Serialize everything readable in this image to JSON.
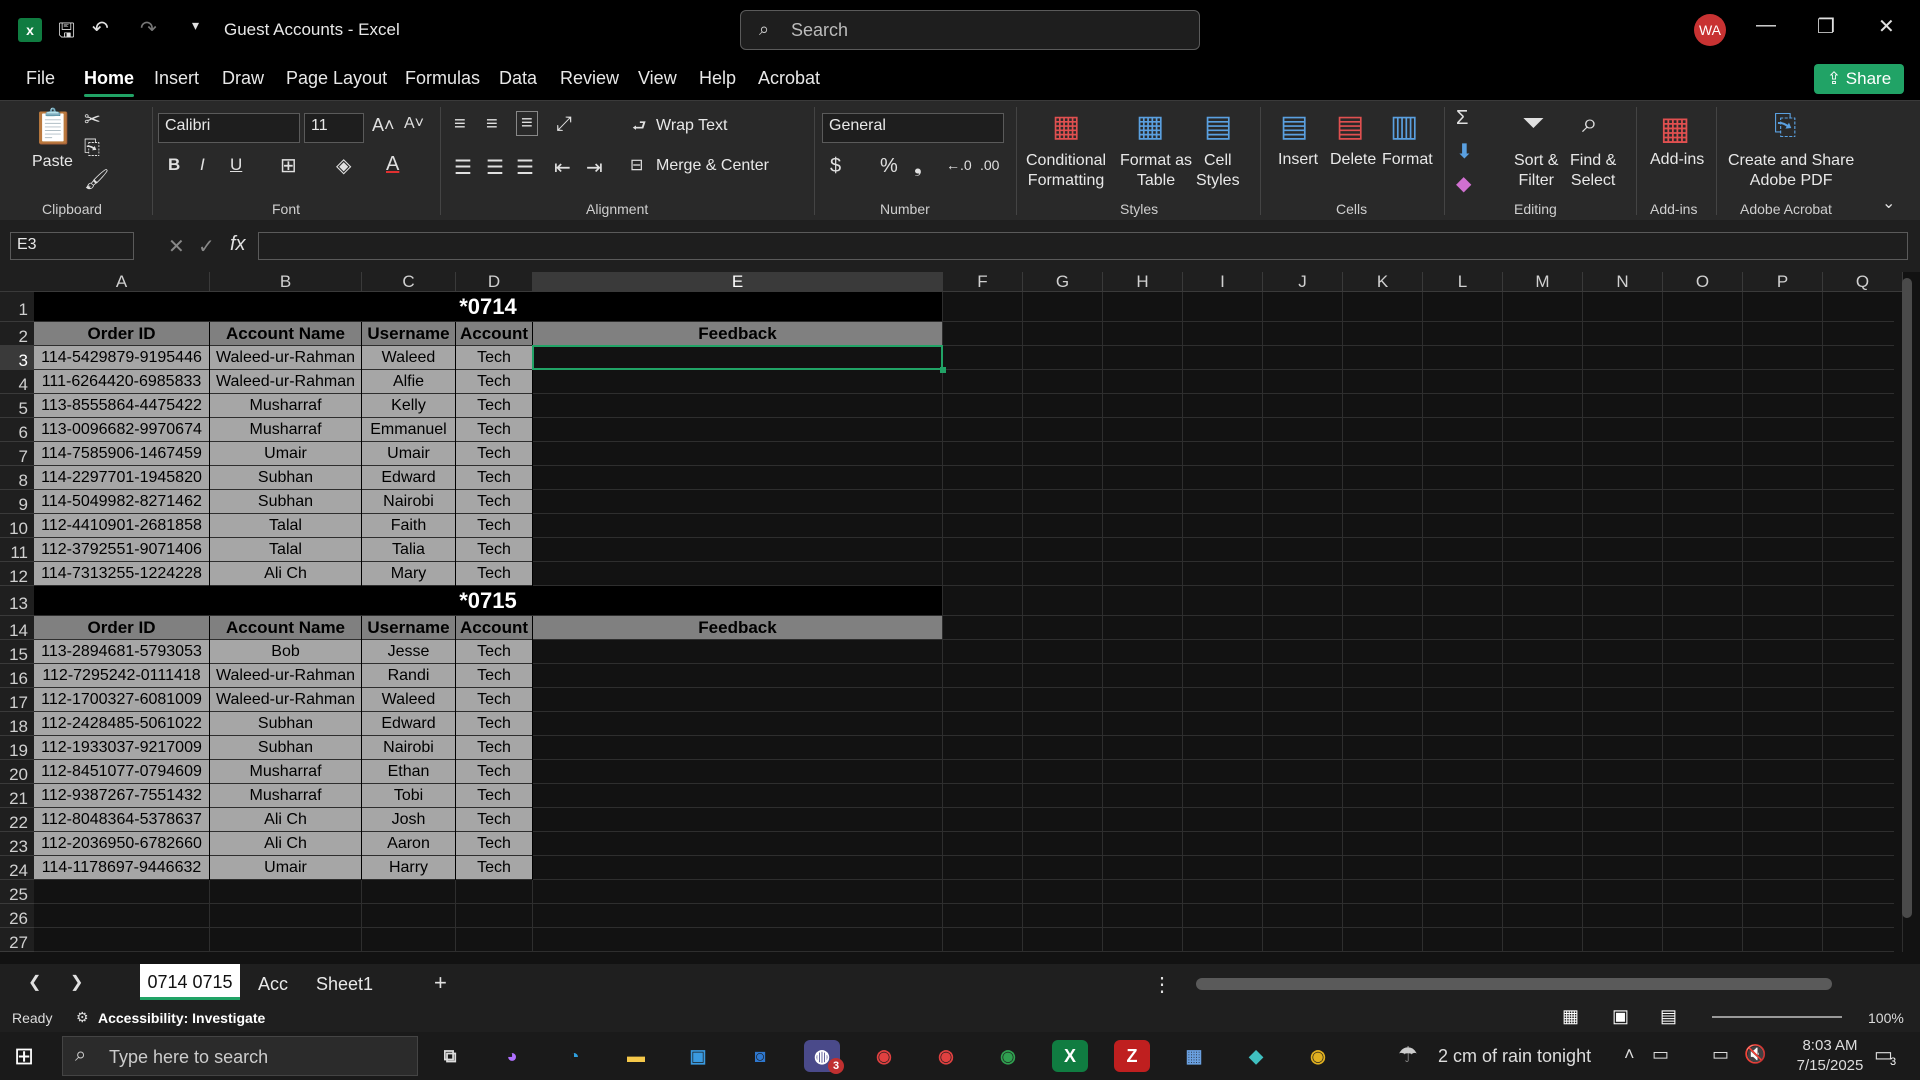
{
  "title_bar": {
    "doc_title": "Guest Accounts - Excel",
    "search_placeholder": "Search",
    "avatar": "WA"
  },
  "menu": [
    "File",
    "Home",
    "Insert",
    "Draw",
    "Page Layout",
    "Formulas",
    "Data",
    "Review",
    "View",
    "Help",
    "Acrobat"
  ],
  "share_label": "Share",
  "ribbon": {
    "paste": "Paste",
    "font_name": "Calibri",
    "font_size": "11",
    "wrap_text": "Wrap Text",
    "merge_center": "Merge & Center",
    "number_format": "General",
    "conditional": [
      "Conditional",
      "Formatting"
    ],
    "format_table": [
      "Format as",
      "Table"
    ],
    "cell_styles": [
      "Cell",
      "Styles"
    ],
    "insert": "Insert",
    "delete": "Delete",
    "format": "Format",
    "sort": [
      "Sort &",
      "Filter"
    ],
    "find": [
      "Find &",
      "Select"
    ],
    "addins": "Add-ins",
    "acrobat": [
      "Create and Share",
      "Adobe PDF"
    ],
    "groups": {
      "clipboard": "Clipboard",
      "font": "Font",
      "alignment": "Alignment",
      "number": "Number",
      "styles": "Styles",
      "cells": "Cells",
      "editing": "Editing",
      "addins": "Add-ins",
      "adobe": "Adobe Acrobat"
    }
  },
  "name_box": "E3",
  "columns": [
    "A",
    "B",
    "C",
    "D",
    "E",
    "F",
    "G",
    "H",
    "I",
    "J",
    "K",
    "L",
    "M",
    "N",
    "O",
    "P",
    "Q"
  ],
  "sections": [
    {
      "title": "*0714",
      "headers": [
        "Order ID",
        "Account Name",
        "Username",
        "Account",
        "Feedback"
      ],
      "rows": [
        [
          "114-5429879-9195446",
          "Waleed-ur-Rahman",
          "Waleed",
          "Tech"
        ],
        [
          "111-6264420-6985833",
          "Waleed-ur-Rahman",
          "Alfie",
          "Tech"
        ],
        [
          "113-8555864-4475422",
          "Musharraf",
          "Kelly",
          "Tech"
        ],
        [
          "113-0096682-9970674",
          "Musharraf",
          "Emmanuel",
          "Tech"
        ],
        [
          "114-7585906-1467459",
          "Umair",
          "Umair",
          "Tech"
        ],
        [
          "114-2297701-1945820",
          "Subhan",
          "Edward",
          "Tech"
        ],
        [
          "114-5049982-8271462",
          "Subhan",
          "Nairobi",
          "Tech"
        ],
        [
          "112-4410901-2681858",
          "Talal",
          "Faith",
          "Tech"
        ],
        [
          "112-3792551-9071406",
          "Talal",
          "Talia",
          "Tech"
        ],
        [
          "114-7313255-1224228",
          "Ali Ch",
          "Mary",
          "Tech"
        ]
      ]
    },
    {
      "title": "*0715",
      "headers": [
        "Order ID",
        "Account Name",
        "Username",
        "Account",
        "Feedback"
      ],
      "rows": [
        [
          "113-2894681-5793053",
          "Bob",
          "Jesse",
          "Tech"
        ],
        [
          "112-7295242-0111418",
          "Waleed-ur-Rahman",
          "Randi",
          "Tech"
        ],
        [
          "112-1700327-6081009",
          "Waleed-ur-Rahman",
          "Waleed",
          "Tech"
        ],
        [
          "112-2428485-5061022",
          "Subhan",
          "Edward",
          "Tech"
        ],
        [
          "112-1933037-9217009",
          "Subhan",
          "Nairobi",
          "Tech"
        ],
        [
          "112-8451077-0794609",
          "Musharraf",
          "Ethan",
          "Tech"
        ],
        [
          "112-9387267-7551432",
          "Musharraf",
          "Tobi",
          "Tech"
        ],
        [
          "112-8048364-5378637",
          "Ali Ch",
          "Josh",
          "Tech"
        ],
        [
          "112-2036950-6782660",
          "Ali Ch",
          "Aaron",
          "Tech"
        ],
        [
          "114-1178697-9446632",
          "Umair",
          "Harry",
          "Tech"
        ]
      ]
    }
  ],
  "sheet_tabs": [
    "0714 0715",
    "Acc",
    "Sheet1"
  ],
  "status": {
    "ready": "Ready",
    "accessibility": "Accessibility: Investigate",
    "zoom": "100%"
  },
  "taskbar": {
    "search_placeholder": "Type here to search",
    "weather": "2 cm of rain tonight",
    "time": "8:03 AM",
    "date": "7/15/2025",
    "notif": "3",
    "outlook_badge": "3"
  },
  "colors": {
    "section_bg": "#000000",
    "header_bg": "#808080",
    "data_bg": "#a6a6a6",
    "accent": "#21a366"
  }
}
